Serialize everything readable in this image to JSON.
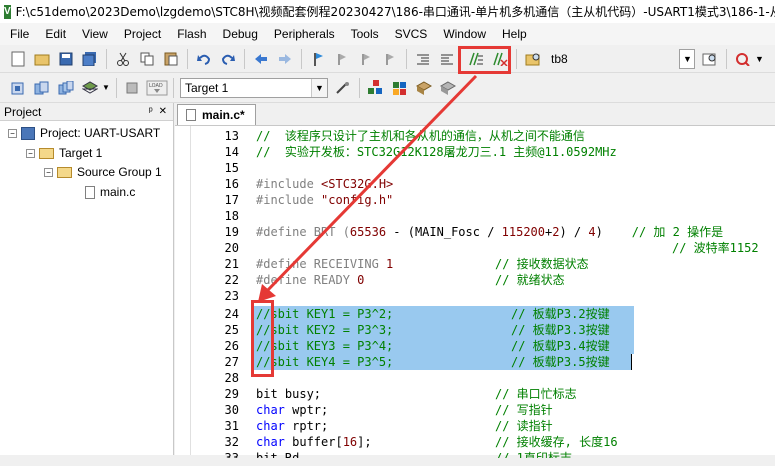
{
  "window": {
    "title": "F:\\c51demo\\2023Demo\\lzgdemo\\STC8H\\视频配套例程20230427\\186-串口通讯-单片机多机通信（主从机代码）-USART1模式3\\186-1-从"
  },
  "menu": [
    "File",
    "Edit",
    "View",
    "Project",
    "Flash",
    "Debug",
    "Peripherals",
    "Tools",
    "SVCS",
    "Window",
    "Help"
  ],
  "toolbar1": {
    "target_label": "tb8"
  },
  "toolbar2": {
    "target_select": "Target 1"
  },
  "project_panel": {
    "title": "Project",
    "pin": "ᵖ",
    "close": "✕",
    "tree": {
      "project": "Project: UART-USART",
      "target": "Target 1",
      "group": "Source Group 1",
      "file": "main.c"
    }
  },
  "editor": {
    "tab_label": "main.c*",
    "line_numbers": [
      "13",
      "14",
      "15",
      "16",
      "17",
      "18",
      "19",
      "20",
      "21",
      "22",
      "23",
      "24",
      "25",
      "26",
      "27",
      "28",
      "29",
      "30",
      "31",
      "32",
      "33"
    ],
    "lines": {
      "l13": "//  该程序只设计了主机和各从机的通信，从机之间不能通信",
      "l14": "//  实验开发板：STC32G12K128屠龙刀三.1 主频@11.0592MHz",
      "l16a": "#include ",
      "l16b": "<STC32G.H>",
      "l17a": "#include ",
      "l17b": "\"config.h\"",
      "l19a": "#define BRT (",
      "l19b": "65536",
      "l19c": " - (MAIN_Fosc / ",
      "l19d": "115200",
      "l19e": "+",
      "l19f": "2",
      "l19g": ") / ",
      "l19h": "4",
      "l19i": ")    ",
      "l19j": "// 加 2 操作是",
      "l20": "// 波特率1152",
      "l21a": "#define RECEIVING ",
      "l21b": "1",
      "l21c": "// 接收数据状态",
      "l22a": "#define READY ",
      "l22b": "0",
      "l22c": "// 就绪状态",
      "l24a": "//sbit KEY1 = P3^2;",
      "l24b": "// 板载P3.2按键",
      "l25a": "//sbit KEY2 = P3^3;",
      "l25b": "// 板载P3.3按键",
      "l26a": "//sbit KEY3 = P3^4;",
      "l26b": "// 板载P3.4按键",
      "l27a": "//sbit KEY4 = P3^5;",
      "l27b": "// 板载P3.5按键",
      "l29a": "bit busy;",
      "l29b": "// 串口忙标志",
      "l30a": "char",
      "l30b": " wptr;",
      "l30c": "// 写指针",
      "l31a": "char",
      "l31b": " rptr;",
      "l31c": "// 读指针",
      "l32a": "char",
      "l32b": " buffer[",
      "l32c": "16",
      "l32d": "];",
      "l32e": "// 接收缓存, 长度16",
      "l33a": "bit Rd",
      "l33b": "// 1直印标志"
    }
  },
  "colors": {
    "annotation": "#e53935",
    "selection": "#99c9ef",
    "comment": "#008000",
    "keyword": "#0000ff"
  }
}
